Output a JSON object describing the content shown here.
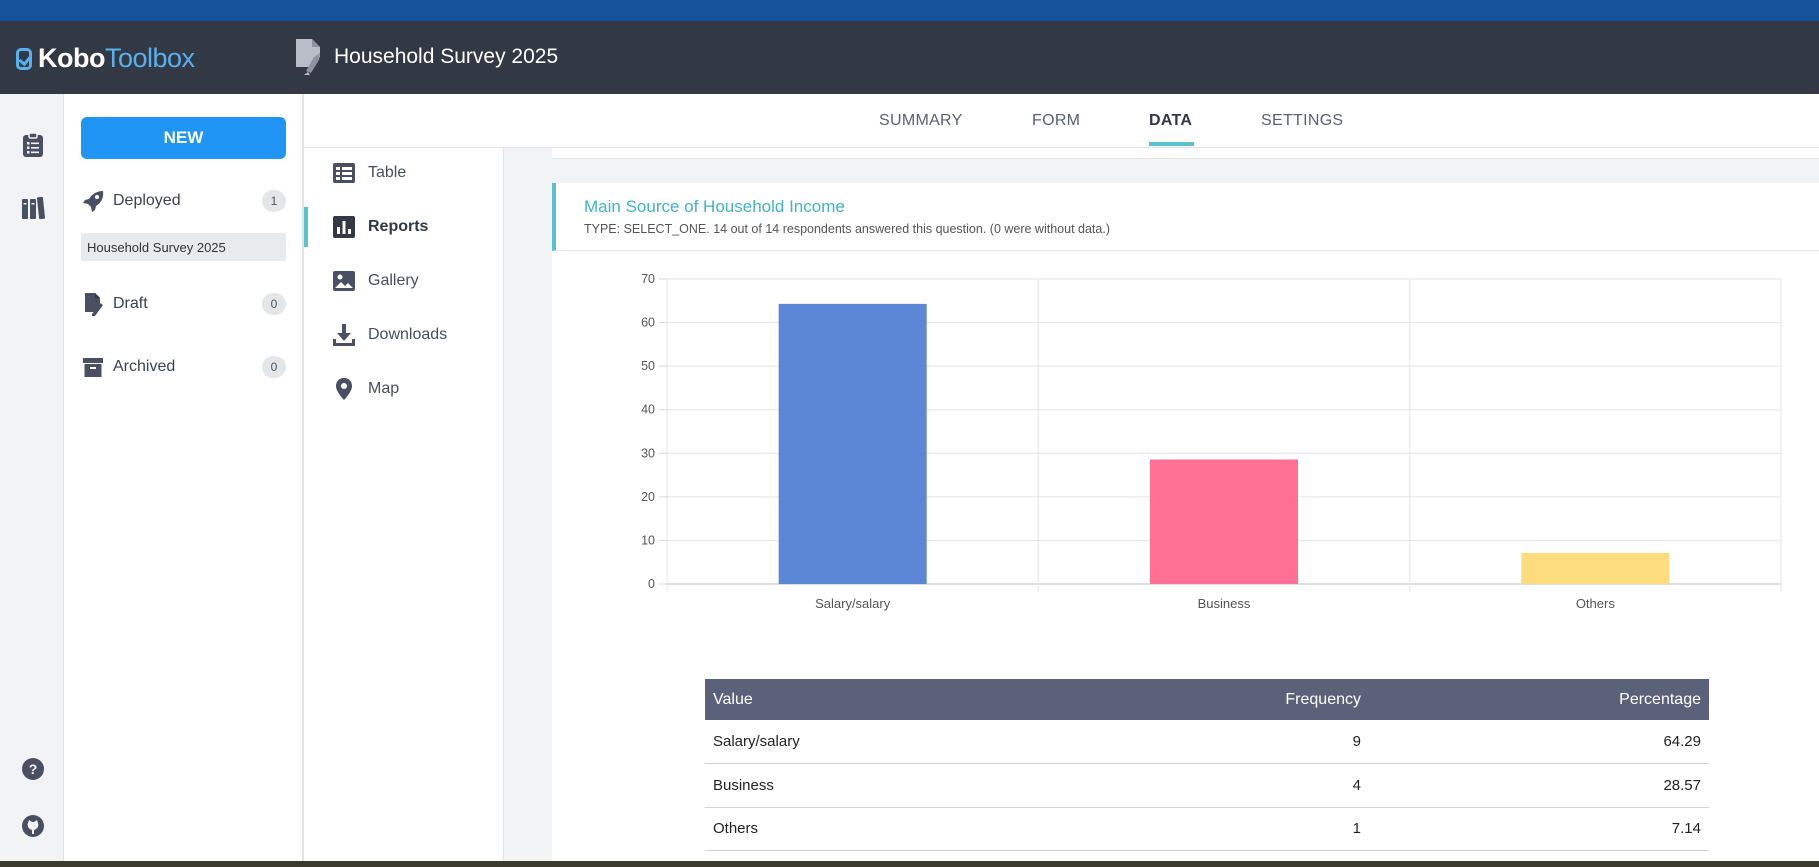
{
  "app": {
    "logo_kobo": "Kobo",
    "logo_toolbox": "Toolbox",
    "project_title": "Household Survey 2025"
  },
  "colors": {
    "accent": "#2095f3",
    "teal": "#5bc0d2",
    "topbar": "#333845",
    "table_header": "#5b6179"
  },
  "sidebar": {
    "new_label": "NEW",
    "deployed": {
      "label": "Deployed",
      "count": "1",
      "project": "Household Survey 2025"
    },
    "draft": {
      "label": "Draft",
      "count": "0"
    },
    "archived": {
      "label": "Archived",
      "count": "0"
    }
  },
  "rail": {
    "icons": [
      "projects-icon",
      "library-icon",
      "help-icon",
      "github-icon"
    ]
  },
  "tabs": {
    "summary": "SUMMARY",
    "form": "FORM",
    "data": "DATA",
    "settings": "SETTINGS",
    "active": "DATA"
  },
  "subnav": {
    "table": "Table",
    "reports": "Reports",
    "gallery": "Gallery",
    "downloads": "Downloads",
    "map": "Map",
    "active": "Reports"
  },
  "question": {
    "title": "Main Source of Household Income",
    "meta": "TYPE: SELECT_ONE. 14 out of 14 respondents answered this question. (0 were without data.)"
  },
  "chart_data": {
    "type": "bar",
    "categories": [
      "Salary/salary",
      "Business",
      "Others"
    ],
    "values": [
      64.29,
      28.57,
      7.14
    ],
    "colors": [
      "#5b87d6",
      "#ff7094",
      "#fddc7e"
    ],
    "yticks": [
      "0",
      "10",
      "20",
      "30",
      "40",
      "50",
      "60",
      "70"
    ],
    "ylim": [
      0,
      70
    ],
    "grid": true,
    "legend": "none"
  },
  "table": {
    "headers": {
      "value": "Value",
      "frequency": "Frequency",
      "percentage": "Percentage"
    },
    "rows": [
      {
        "value": "Salary/salary",
        "frequency": "9",
        "percentage": "64.29"
      },
      {
        "value": "Business",
        "frequency": "4",
        "percentage": "28.57"
      },
      {
        "value": "Others",
        "frequency": "1",
        "percentage": "7.14"
      }
    ]
  }
}
